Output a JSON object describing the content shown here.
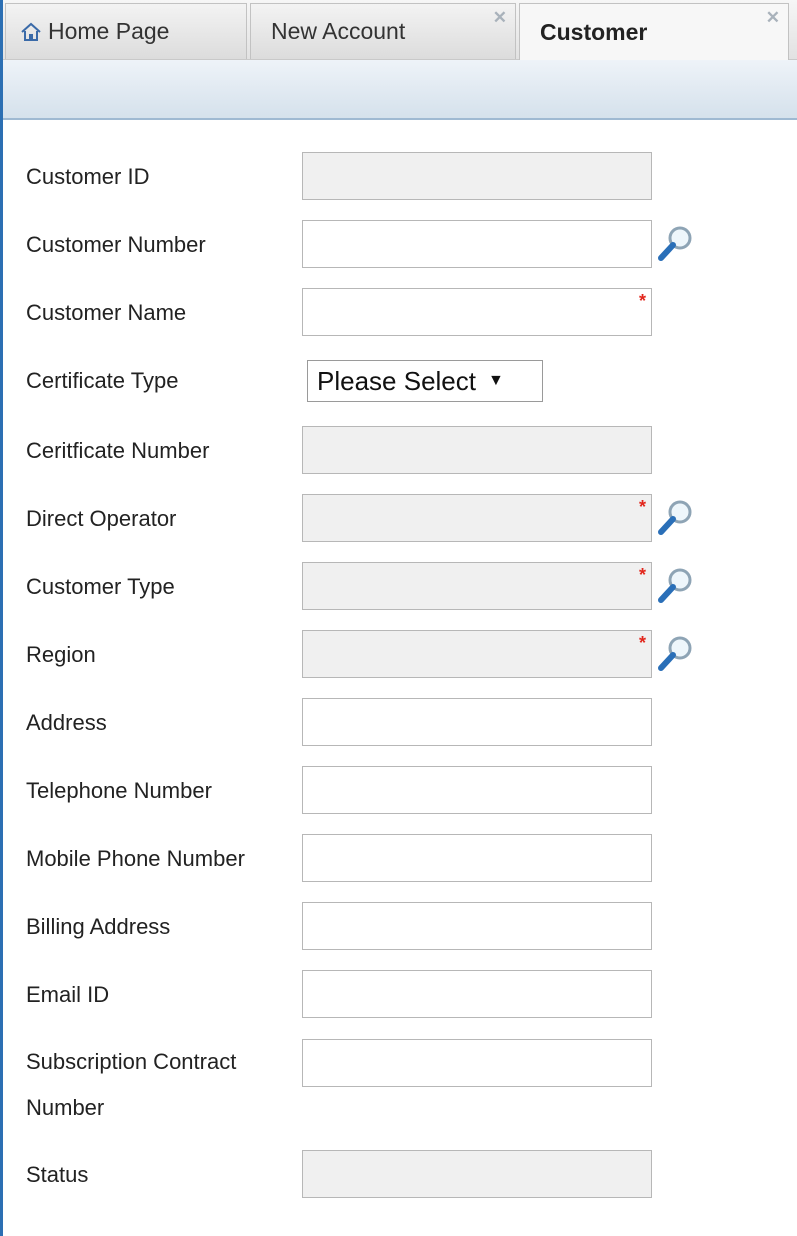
{
  "tabs": [
    {
      "label": "Home Page",
      "icon": "home-icon",
      "active": false,
      "closable": false
    },
    {
      "label": "New Account",
      "active": false,
      "closable": true,
      "close_glyph": "✕"
    },
    {
      "label": "Customer",
      "active": true,
      "closable": true,
      "close_glyph": "✕"
    }
  ],
  "form": {
    "customer_id": {
      "label": "Customer ID",
      "value": ""
    },
    "customer_number": {
      "label": "Customer Number",
      "value": ""
    },
    "customer_name": {
      "label": "Customer Name",
      "value": "",
      "required_mark": "*"
    },
    "certificate_type": {
      "label": "Certificate Type",
      "selected": "Please Select",
      "arrow": "▼"
    },
    "certificate_number": {
      "label": "Ceritficate Number",
      "value": ""
    },
    "direct_operator": {
      "label": "Direct Operator",
      "value": "",
      "required_mark": "*"
    },
    "customer_type": {
      "label": "Customer Type",
      "value": "",
      "required_mark": "*"
    },
    "region": {
      "label": "Region",
      "value": "",
      "required_mark": "*"
    },
    "address": {
      "label": "Address",
      "value": ""
    },
    "telephone_number": {
      "label": "Telephone Number",
      "value": ""
    },
    "mobile_phone_number": {
      "label": "Mobile Phone Number",
      "value": ""
    },
    "billing_address": {
      "label": "Billing Address",
      "value": ""
    },
    "email_id": {
      "label": "Email ID",
      "value": ""
    },
    "subscription_contract_number": {
      "label_line1": "Subscription Contract",
      "label_line2": "Number",
      "value": ""
    },
    "status": {
      "label": "Status",
      "value": ""
    }
  },
  "colors": {
    "accent_border": "#2c6fb3",
    "required": "#e2261c",
    "readonly_field": "#f0f0f0"
  }
}
